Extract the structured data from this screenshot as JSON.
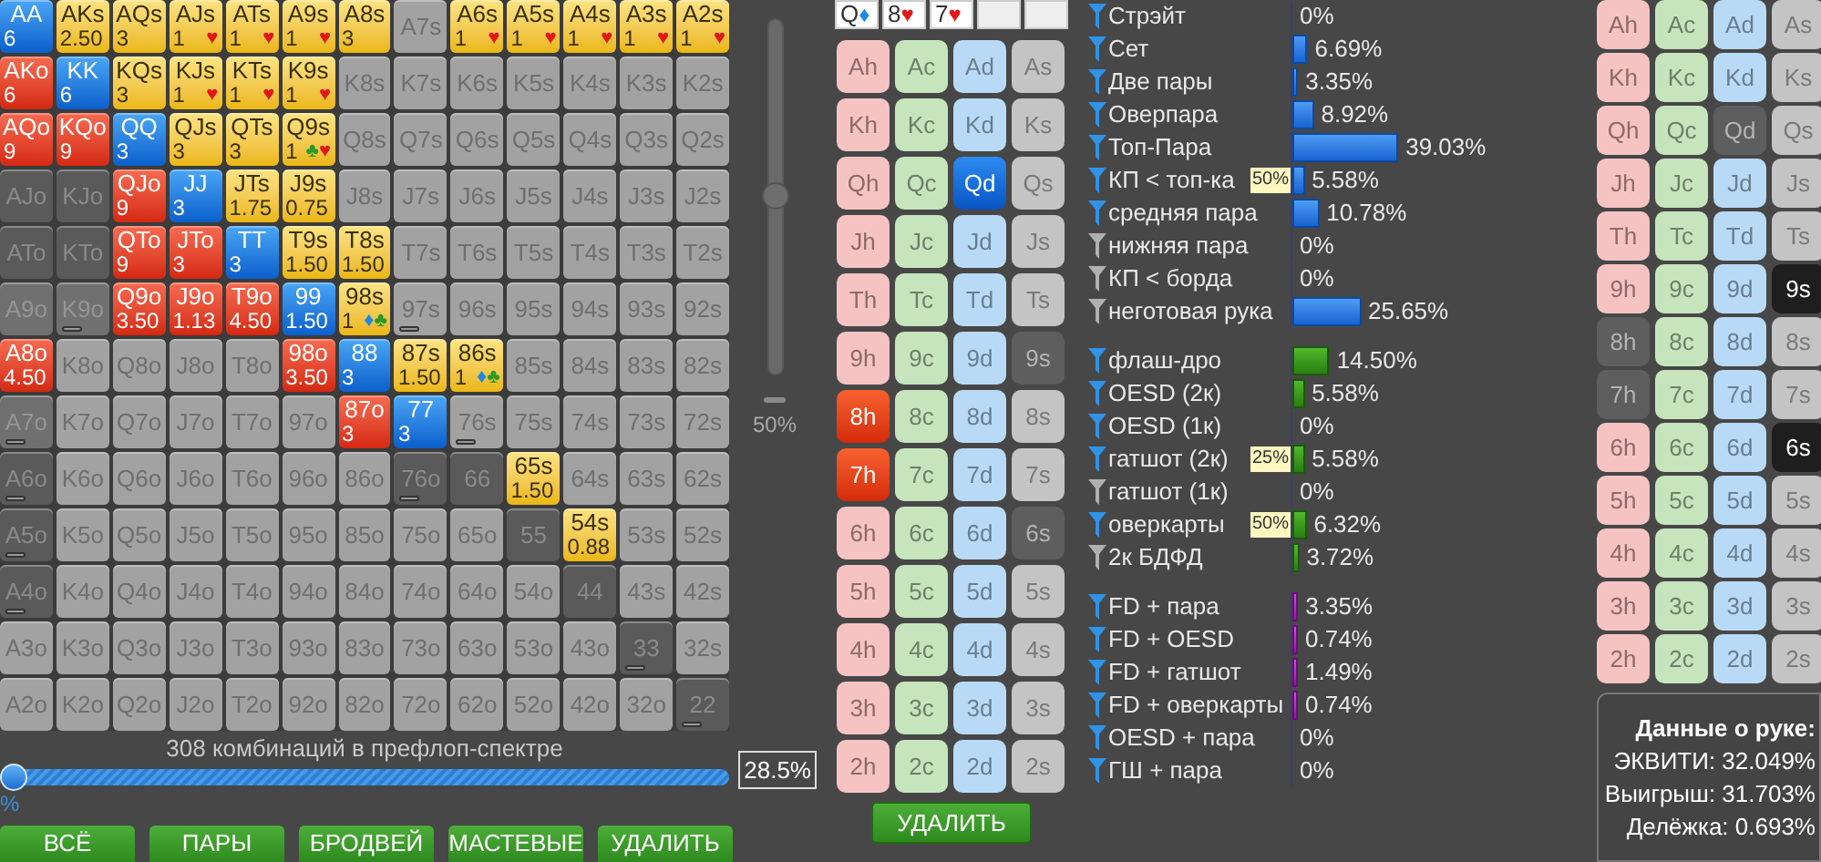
{
  "matrix": {
    "rows": [
      [
        {
          "label": "AA",
          "kind": "pair",
          "marked": false,
          "weight": "6"
        },
        {
          "label": "AKs",
          "kind": "suited",
          "marked": false,
          "weight": "2.50"
        },
        {
          "label": "AQs",
          "kind": "suited",
          "marked": false,
          "weight": "3"
        },
        {
          "label": "AJs",
          "kind": "suited",
          "marked": false,
          "weight": "1",
          "suits": [
            {
              "symbol": "♥",
              "color": "#e01818"
            }
          ]
        },
        {
          "label": "ATs",
          "kind": "suited",
          "marked": false,
          "weight": "1",
          "suits": [
            {
              "symbol": "♥",
              "color": "#e01818"
            }
          ]
        },
        {
          "label": "A9s",
          "kind": "suited",
          "marked": false,
          "weight": "1",
          "suits": [
            {
              "symbol": "♥",
              "color": "#e01818"
            }
          ]
        },
        {
          "label": "A8s",
          "kind": "suited",
          "marked": false,
          "weight": "3"
        },
        {
          "label": "A7s",
          "kind": "empty",
          "marked": false
        },
        {
          "label": "A6s",
          "kind": "suited",
          "marked": false,
          "weight": "1",
          "suits": [
            {
              "symbol": "♥",
              "color": "#e01818"
            }
          ]
        },
        {
          "label": "A5s",
          "kind": "suited",
          "marked": false,
          "weight": "1",
          "suits": [
            {
              "symbol": "♥",
              "color": "#e01818"
            }
          ]
        },
        {
          "label": "A4s",
          "kind": "suited",
          "marked": false,
          "weight": "1",
          "suits": [
            {
              "symbol": "♥",
              "color": "#e01818"
            }
          ]
        },
        {
          "label": "A3s",
          "kind": "suited",
          "marked": false,
          "weight": "1",
          "suits": [
            {
              "symbol": "♥",
              "color": "#e01818"
            }
          ]
        },
        {
          "label": "A2s",
          "kind": "suited",
          "marked": false,
          "weight": "1",
          "suits": [
            {
              "symbol": "♥",
              "color": "#e01818"
            }
          ]
        }
      ],
      [
        {
          "label": "AKo",
          "kind": "offsuit",
          "marked": false,
          "weight": "6"
        },
        {
          "label": "KK",
          "kind": "pair",
          "marked": false,
          "weight": "6"
        },
        {
          "label": "KQs",
          "kind": "suited",
          "marked": false,
          "weight": "3"
        },
        {
          "label": "KJs",
          "kind": "suited",
          "marked": false,
          "weight": "1",
          "suits": [
            {
              "symbol": "♥",
              "color": "#e01818"
            }
          ]
        },
        {
          "label": "KTs",
          "kind": "suited",
          "marked": false,
          "weight": "1",
          "suits": [
            {
              "symbol": "♥",
              "color": "#e01818"
            }
          ]
        },
        {
          "label": "K9s",
          "kind": "suited",
          "marked": false,
          "weight": "1",
          "suits": [
            {
              "symbol": "♥",
              "color": "#e01818"
            }
          ]
        },
        {
          "label": "K8s",
          "kind": "empty",
          "marked": false
        },
        {
          "label": "K7s",
          "kind": "empty",
          "marked": false
        },
        {
          "label": "K6s",
          "kind": "empty",
          "marked": false
        },
        {
          "label": "K5s",
          "kind": "empty",
          "marked": false
        },
        {
          "label": "K4s",
          "kind": "empty",
          "marked": false
        },
        {
          "label": "K3s",
          "kind": "empty",
          "marked": false
        },
        {
          "label": "K2s",
          "kind": "empty",
          "marked": false
        }
      ],
      [
        {
          "label": "AQo",
          "kind": "offsuit",
          "marked": false,
          "weight": "9"
        },
        {
          "label": "KQo",
          "kind": "offsuit",
          "marked": false,
          "weight": "9"
        },
        {
          "label": "QQ",
          "kind": "pair",
          "marked": false,
          "weight": "3"
        },
        {
          "label": "QJs",
          "kind": "suited",
          "marked": false,
          "weight": "3"
        },
        {
          "label": "QTs",
          "kind": "suited",
          "marked": false,
          "weight": "3"
        },
        {
          "label": "Q9s",
          "kind": "suited",
          "marked": false,
          "weight": "1",
          "suits": [
            {
              "symbol": "♣",
              "color": "#2a9a2a"
            },
            {
              "symbol": "♥",
              "color": "#e01818"
            }
          ]
        },
        {
          "label": "Q8s",
          "kind": "empty",
          "marked": false
        },
        {
          "label": "Q7s",
          "kind": "empty",
          "marked": false
        },
        {
          "label": "Q6s",
          "kind": "empty",
          "marked": false
        },
        {
          "label": "Q5s",
          "kind": "empty",
          "marked": false
        },
        {
          "label": "Q4s",
          "kind": "empty",
          "marked": false
        },
        {
          "label": "Q3s",
          "kind": "empty",
          "marked": false
        },
        {
          "label": "Q2s",
          "kind": "empty",
          "marked": false
        }
      ],
      [
        {
          "label": "AJo",
          "kind": "dead",
          "marked": false
        },
        {
          "label": "KJo",
          "kind": "dead",
          "marked": false
        },
        {
          "label": "QJo",
          "kind": "offsuit",
          "marked": false,
          "weight": "9"
        },
        {
          "label": "JJ",
          "kind": "pair",
          "marked": false,
          "weight": "3"
        },
        {
          "label": "JTs",
          "kind": "suited",
          "marked": false,
          "weight": "1.75"
        },
        {
          "label": "J9s",
          "kind": "suited",
          "marked": false,
          "weight": "0.75"
        },
        {
          "label": "J8s",
          "kind": "empty",
          "marked": false
        },
        {
          "label": "J7s",
          "kind": "empty",
          "marked": false
        },
        {
          "label": "J6s",
          "kind": "empty",
          "marked": false
        },
        {
          "label": "J5s",
          "kind": "empty",
          "marked": false
        },
        {
          "label": "J4s",
          "kind": "empty",
          "marked": false
        },
        {
          "label": "J3s",
          "kind": "empty",
          "marked": false
        },
        {
          "label": "J2s",
          "kind": "empty",
          "marked": false
        }
      ],
      [
        {
          "label": "ATo",
          "kind": "dead",
          "marked": false
        },
        {
          "label": "KTo",
          "kind": "dead",
          "marked": false
        },
        {
          "label": "QTo",
          "kind": "offsuit",
          "marked": false,
          "weight": "9"
        },
        {
          "label": "JTo",
          "kind": "offsuit",
          "marked": false,
          "weight": "3"
        },
        {
          "label": "TT",
          "kind": "pair",
          "marked": false,
          "weight": "3"
        },
        {
          "label": "T9s",
          "kind": "suited",
          "marked": false,
          "weight": "1.50"
        },
        {
          "label": "T8s",
          "kind": "suited",
          "marked": false,
          "weight": "1.50"
        },
        {
          "label": "T7s",
          "kind": "empty",
          "marked": false
        },
        {
          "label": "T6s",
          "kind": "empty",
          "marked": false
        },
        {
          "label": "T5s",
          "kind": "empty",
          "marked": false
        },
        {
          "label": "T4s",
          "kind": "empty",
          "marked": false
        },
        {
          "label": "T3s",
          "kind": "empty",
          "marked": false
        },
        {
          "label": "T2s",
          "kind": "empty",
          "marked": false
        }
      ],
      [
        {
          "label": "A9o",
          "kind": "dim",
          "marked": false
        },
        {
          "label": "K9o",
          "kind": "dim",
          "marked": true
        },
        {
          "label": "Q9o",
          "kind": "offsuit",
          "marked": false,
          "weight": "3.50"
        },
        {
          "label": "J9o",
          "kind": "offsuit",
          "marked": false,
          "weight": "1.13"
        },
        {
          "label": "T9o",
          "kind": "offsuit",
          "marked": false,
          "weight": "4.50"
        },
        {
          "label": "99",
          "kind": "pair",
          "marked": false,
          "weight": "1.50"
        },
        {
          "label": "98s",
          "kind": "suited",
          "marked": false,
          "weight": "1",
          "suits": [
            {
              "symbol": "♦",
              "color": "#1e88e5"
            },
            {
              "symbol": "♣",
              "color": "#2a9a2a"
            }
          ]
        },
        {
          "label": "97s",
          "kind": "empty",
          "marked": true
        },
        {
          "label": "96s",
          "kind": "empty",
          "marked": false
        },
        {
          "label": "95s",
          "kind": "empty",
          "marked": false
        },
        {
          "label": "94s",
          "kind": "empty",
          "marked": false
        },
        {
          "label": "93s",
          "kind": "empty",
          "marked": false
        },
        {
          "label": "92s",
          "kind": "empty",
          "marked": false
        }
      ],
      [
        {
          "label": "A8o",
          "kind": "offsuit",
          "marked": false,
          "weight": "4.50"
        },
        {
          "label": "K8o",
          "kind": "empty",
          "marked": false
        },
        {
          "label": "Q8o",
          "kind": "empty",
          "marked": false
        },
        {
          "label": "J8o",
          "kind": "empty",
          "marked": false
        },
        {
          "label": "T8o",
          "kind": "empty",
          "marked": false
        },
        {
          "label": "98o",
          "kind": "offsuit",
          "marked": false,
          "weight": "3.50"
        },
        {
          "label": "88",
          "kind": "pair",
          "marked": false,
          "weight": "3"
        },
        {
          "label": "87s",
          "kind": "suited",
          "marked": false,
          "weight": "1.50"
        },
        {
          "label": "86s",
          "kind": "suited",
          "marked": false,
          "weight": "1",
          "suits": [
            {
              "symbol": "♦",
              "color": "#1e88e5"
            },
            {
              "symbol": "♣",
              "color": "#2a9a2a"
            }
          ]
        },
        {
          "label": "85s",
          "kind": "empty",
          "marked": false
        },
        {
          "label": "84s",
          "kind": "empty",
          "marked": false
        },
        {
          "label": "83s",
          "kind": "empty",
          "marked": false
        },
        {
          "label": "82s",
          "kind": "empty",
          "marked": false
        }
      ],
      [
        {
          "label": "A7o",
          "kind": "dim",
          "marked": true
        },
        {
          "label": "K7o",
          "kind": "empty",
          "marked": false
        },
        {
          "label": "Q7o",
          "kind": "empty",
          "marked": false
        },
        {
          "label": "J7o",
          "kind": "empty",
          "marked": false
        },
        {
          "label": "T7o",
          "kind": "empty",
          "marked": false
        },
        {
          "label": "97o",
          "kind": "empty",
          "marked": false
        },
        {
          "label": "87o",
          "kind": "offsuit",
          "marked": false,
          "weight": "3"
        },
        {
          "label": "77",
          "kind": "pair",
          "marked": false,
          "weight": "3"
        },
        {
          "label": "76s",
          "kind": "empty",
          "marked": true
        },
        {
          "label": "75s",
          "kind": "empty",
          "marked": false
        },
        {
          "label": "74s",
          "kind": "empty",
          "marked": false
        },
        {
          "label": "73s",
          "kind": "empty",
          "marked": false
        },
        {
          "label": "72s",
          "kind": "empty",
          "marked": false
        }
      ],
      [
        {
          "label": "A6o",
          "kind": "dead",
          "marked": true
        },
        {
          "label": "K6o",
          "kind": "empty",
          "marked": false
        },
        {
          "label": "Q6o",
          "kind": "empty",
          "marked": false
        },
        {
          "label": "J6o",
          "kind": "empty",
          "marked": false
        },
        {
          "label": "T6o",
          "kind": "empty",
          "marked": false
        },
        {
          "label": "96o",
          "kind": "empty",
          "marked": false
        },
        {
          "label": "86o",
          "kind": "empty",
          "marked": false
        },
        {
          "label": "76o",
          "kind": "dead",
          "marked": true
        },
        {
          "label": "66",
          "kind": "dead",
          "marked": false
        },
        {
          "label": "65s",
          "kind": "suited",
          "marked": false,
          "weight": "1.50"
        },
        {
          "label": "64s",
          "kind": "empty",
          "marked": false
        },
        {
          "label": "63s",
          "kind": "empty",
          "marked": false
        },
        {
          "label": "62s",
          "kind": "empty",
          "marked": false
        }
      ],
      [
        {
          "label": "A5o",
          "kind": "dead",
          "marked": true
        },
        {
          "label": "K5o",
          "kind": "empty",
          "marked": false
        },
        {
          "label": "Q5o",
          "kind": "empty",
          "marked": false
        },
        {
          "label": "J5o",
          "kind": "empty",
          "marked": false
        },
        {
          "label": "T5o",
          "kind": "empty",
          "marked": false
        },
        {
          "label": "95o",
          "kind": "empty",
          "marked": false
        },
        {
          "label": "85o",
          "kind": "empty",
          "marked": false
        },
        {
          "label": "75o",
          "kind": "empty",
          "marked": false
        },
        {
          "label": "65o",
          "kind": "empty",
          "marked": false
        },
        {
          "label": "55",
          "kind": "dead",
          "marked": false
        },
        {
          "label": "54s",
          "kind": "suited",
          "marked": false,
          "weight": "0.88"
        },
        {
          "label": "53s",
          "kind": "empty",
          "marked": false
        },
        {
          "label": "52s",
          "kind": "empty",
          "marked": false
        }
      ],
      [
        {
          "label": "A4o",
          "kind": "dead",
          "marked": true
        },
        {
          "label": "K4o",
          "kind": "empty",
          "marked": false
        },
        {
          "label": "Q4o",
          "kind": "empty",
          "marked": false
        },
        {
          "label": "J4o",
          "kind": "empty",
          "marked": false
        },
        {
          "label": "T4o",
          "kind": "empty",
          "marked": false
        },
        {
          "label": "94o",
          "kind": "empty",
          "marked": false
        },
        {
          "label": "84o",
          "kind": "empty",
          "marked": false
        },
        {
          "label": "74o",
          "kind": "empty",
          "marked": false
        },
        {
          "label": "64o",
          "kind": "empty",
          "marked": false
        },
        {
          "label": "54o",
          "kind": "empty",
          "marked": false
        },
        {
          "label": "44",
          "kind": "dead",
          "marked": false
        },
        {
          "label": "43s",
          "kind": "empty",
          "marked": false
        },
        {
          "label": "42s",
          "kind": "empty",
          "marked": false
        }
      ],
      [
        {
          "label": "A3o",
          "kind": "empty",
          "marked": false
        },
        {
          "label": "K3o",
          "kind": "empty",
          "marked": false
        },
        {
          "label": "Q3o",
          "kind": "empty",
          "marked": false
        },
        {
          "label": "J3o",
          "kind": "empty",
          "marked": false
        },
        {
          "label": "T3o",
          "kind": "empty",
          "marked": false
        },
        {
          "label": "93o",
          "kind": "empty",
          "marked": false
        },
        {
          "label": "83o",
          "kind": "empty",
          "marked": false
        },
        {
          "label": "73o",
          "kind": "empty",
          "marked": false
        },
        {
          "label": "63o",
          "kind": "empty",
          "marked": false
        },
        {
          "label": "53o",
          "kind": "empty",
          "marked": false
        },
        {
          "label": "43o",
          "kind": "empty",
          "marked": false
        },
        {
          "label": "33",
          "kind": "dead",
          "marked": true
        },
        {
          "label": "32s",
          "kind": "empty",
          "marked": false
        }
      ],
      [
        {
          "label": "A2o",
          "kind": "empty",
          "marked": false
        },
        {
          "label": "K2o",
          "kind": "empty",
          "marked": false
        },
        {
          "label": "Q2o",
          "kind": "empty",
          "marked": false
        },
        {
          "label": "J2o",
          "kind": "empty",
          "marked": false
        },
        {
          "label": "T2o",
          "kind": "empty",
          "marked": false
        },
        {
          "label": "92o",
          "kind": "empty",
          "marked": false
        },
        {
          "label": "82o",
          "kind": "empty",
          "marked": false
        },
        {
          "label": "72o",
          "kind": "empty",
          "marked": false
        },
        {
          "label": "62o",
          "kind": "empty",
          "marked": false
        },
        {
          "label": "52o",
          "kind": "empty",
          "marked": false
        },
        {
          "label": "42o",
          "kind": "empty",
          "marked": false
        },
        {
          "label": "32o",
          "kind": "empty",
          "marked": false
        },
        {
          "label": "22",
          "kind": "dead",
          "marked": true
        }
      ]
    ]
  },
  "vertical_slider": {
    "level": 0.5,
    "label": "50%"
  },
  "combo_caption": "308 комбинаций в префлоп-спектре",
  "range_slider": {
    "level": 0,
    "min_label": "%",
    "value": "28.5%"
  },
  "range_buttons": [
    "ВСЁ",
    "ПАРЫ",
    "БРОДВЕЙ",
    "МАСТЕВЫЕ",
    "УДАЛИТЬ"
  ],
  "board": [
    {
      "filled": true,
      "rank": "Q",
      "suit": {
        "symbol": "♦",
        "color": "#1e88e5"
      }
    },
    {
      "filled": true,
      "rank": "8",
      "suit": {
        "symbol": "♥",
        "color": "#e01818"
      }
    },
    {
      "filled": true,
      "rank": "7",
      "suit": {
        "symbol": "♥",
        "color": "#e01818"
      }
    },
    {
      "filled": false
    },
    {
      "filled": false
    }
  ],
  "board_cards": {
    "kind": "board",
    "columns": [
      {
        "kind": "hearts",
        "cards": [
          {
            "label": "Ah",
            "selected": false,
            "disabled": false
          },
          {
            "label": "Kh",
            "selected": false,
            "disabled": false
          },
          {
            "label": "Qh",
            "selected": false,
            "disabled": false
          },
          {
            "label": "Jh",
            "selected": false,
            "disabled": false
          },
          {
            "label": "Th",
            "selected": false,
            "disabled": false
          },
          {
            "label": "9h",
            "selected": false,
            "disabled": false
          },
          {
            "label": "8h",
            "selected": true,
            "disabled": false
          },
          {
            "label": "7h",
            "selected": true,
            "disabled": false
          },
          {
            "label": "6h",
            "selected": false,
            "disabled": false
          },
          {
            "label": "5h",
            "selected": false,
            "disabled": false
          },
          {
            "label": "4h",
            "selected": false,
            "disabled": false
          },
          {
            "label": "3h",
            "selected": false,
            "disabled": false
          },
          {
            "label": "2h",
            "selected": false,
            "disabled": false
          }
        ]
      },
      {
        "kind": "clubs",
        "cards": [
          {
            "label": "Ac",
            "selected": false,
            "disabled": false
          },
          {
            "label": "Kc",
            "selected": false,
            "disabled": false
          },
          {
            "label": "Qc",
            "selected": false,
            "disabled": false
          },
          {
            "label": "Jc",
            "selected": false,
            "disabled": false
          },
          {
            "label": "Tc",
            "selected": false,
            "disabled": false
          },
          {
            "label": "9c",
            "selected": false,
            "disabled": false
          },
          {
            "label": "8c",
            "selected": false,
            "disabled": false
          },
          {
            "label": "7c",
            "selected": false,
            "disabled": false
          },
          {
            "label": "6c",
            "selected": false,
            "disabled": false
          },
          {
            "label": "5c",
            "selected": false,
            "disabled": false
          },
          {
            "label": "4c",
            "selected": false,
            "disabled": false
          },
          {
            "label": "3c",
            "selected": false,
            "disabled": false
          },
          {
            "label": "2c",
            "selected": false,
            "disabled": false
          }
        ]
      },
      {
        "kind": "diamonds",
        "cards": [
          {
            "label": "Ad",
            "selected": false,
            "disabled": false
          },
          {
            "label": "Kd",
            "selected": false,
            "disabled": false
          },
          {
            "label": "Qd",
            "selected": true,
            "disabled": false
          },
          {
            "label": "Jd",
            "selected": false,
            "disabled": false
          },
          {
            "label": "Td",
            "selected": false,
            "disabled": false
          },
          {
            "label": "9d",
            "selected": false,
            "disabled": false
          },
          {
            "label": "8d",
            "selected": false,
            "disabled": false
          },
          {
            "label": "7d",
            "selected": false,
            "disabled": false
          },
          {
            "label": "6d",
            "selected": false,
            "disabled": false
          },
          {
            "label": "5d",
            "selected": false,
            "disabled": false
          },
          {
            "label": "4d",
            "selected": false,
            "disabled": false
          },
          {
            "label": "3d",
            "selected": false,
            "disabled": false
          },
          {
            "label": "2d",
            "selected": false,
            "disabled": false
          }
        ]
      },
      {
        "kind": "spades",
        "cards": [
          {
            "label": "As",
            "selected": false,
            "disabled": false
          },
          {
            "label": "Ks",
            "selected": false,
            "disabled": false
          },
          {
            "label": "Qs",
            "selected": false,
            "disabled": false
          },
          {
            "label": "Js",
            "selected": false,
            "disabled": false
          },
          {
            "label": "Ts",
            "selected": false,
            "disabled": false
          },
          {
            "label": "9s",
            "selected": false,
            "disabled": true
          },
          {
            "label": "8s",
            "selected": false,
            "disabled": false
          },
          {
            "label": "7s",
            "selected": false,
            "disabled": false
          },
          {
            "label": "6s",
            "selected": false,
            "disabled": true
          },
          {
            "label": "5s",
            "selected": false,
            "disabled": false
          },
          {
            "label": "4s",
            "selected": false,
            "disabled": false
          },
          {
            "label": "3s",
            "selected": false,
            "disabled": false
          },
          {
            "label": "2s",
            "selected": false,
            "disabled": false
          }
        ]
      }
    ]
  },
  "board_delete_button": "УДАЛИТЬ",
  "stats": [
    {
      "kind": "made",
      "rows": [
        {
          "label": "Стрэйт",
          "active": true,
          "value": "0%"
        },
        {
          "label": "Сет",
          "active": true,
          "value": "6.69%"
        },
        {
          "label": "Две пары",
          "active": true,
          "value": "3.35%"
        },
        {
          "label": "Оверпара",
          "active": true,
          "value": "8.92%"
        },
        {
          "label": "Топ-Пара",
          "active": true,
          "value": "39.03%"
        },
        {
          "label": "КП < топ-ка",
          "badge": "50%",
          "active": true,
          "value": "5.58%"
        },
        {
          "label": "средняя пара",
          "active": true,
          "value": "10.78%"
        },
        {
          "label": "нижняя пара",
          "active": false,
          "value": "0%"
        },
        {
          "label": "КП < борда",
          "active": false,
          "value": "0%"
        },
        {
          "label": "неготовая рука",
          "active": false,
          "value": "25.65%"
        }
      ]
    },
    {
      "kind": "draw",
      "rows": [
        {
          "label": "флаш-дро",
          "active": true,
          "value": "14.50%"
        },
        {
          "label": "OESD (2к)",
          "active": true,
          "value": "5.58%"
        },
        {
          "label": "OESD (1к)",
          "active": true,
          "value": "0%"
        },
        {
          "label": "гатшот (2к)",
          "badge": "25%",
          "active": true,
          "value": "5.58%"
        },
        {
          "label": "гатшот (1к)",
          "active": false,
          "value": "0%"
        },
        {
          "label": "оверкарты",
          "badge": "50%",
          "active": true,
          "value": "6.32%"
        },
        {
          "label": "2к БДФД",
          "active": false,
          "value": "3.72%"
        }
      ]
    },
    {
      "kind": "combo",
      "rows": [
        {
          "label": "FD + пара",
          "active": true,
          "value": "3.35%"
        },
        {
          "label": "FD + OESD",
          "active": true,
          "value": "0.74%"
        },
        {
          "label": "FD + гатшот",
          "active": true,
          "value": "1.49%"
        },
        {
          "label": "FD + оверкарты",
          "active": true,
          "value": "0.74%"
        },
        {
          "label": "OESD + пара",
          "active": true,
          "value": "0%"
        },
        {
          "label": "ГШ + пара",
          "active": true,
          "value": "0%"
        }
      ]
    }
  ],
  "hand_cards": {
    "kind": "hand",
    "columns": [
      {
        "kind": "hearts",
        "cards": [
          {
            "label": "Ah",
            "selected": false,
            "disabled": false
          },
          {
            "label": "Kh",
            "selected": false,
            "disabled": false
          },
          {
            "label": "Qh",
            "selected": false,
            "disabled": false
          },
          {
            "label": "Jh",
            "selected": false,
            "disabled": false
          },
          {
            "label": "Th",
            "selected": false,
            "disabled": false
          },
          {
            "label": "9h",
            "selected": false,
            "disabled": false
          },
          {
            "label": "8h",
            "selected": false,
            "disabled": true
          },
          {
            "label": "7h",
            "selected": false,
            "disabled": true
          },
          {
            "label": "6h",
            "selected": false,
            "disabled": false
          },
          {
            "label": "5h",
            "selected": false,
            "disabled": false
          },
          {
            "label": "4h",
            "selected": false,
            "disabled": false
          },
          {
            "label": "3h",
            "selected": false,
            "disabled": false
          },
          {
            "label": "2h",
            "selected": false,
            "disabled": false
          }
        ]
      },
      {
        "kind": "clubs",
        "cards": [
          {
            "label": "Ac",
            "selected": false,
            "disabled": false
          },
          {
            "label": "Kc",
            "selected": false,
            "disabled": false
          },
          {
            "label": "Qc",
            "selected": false,
            "disabled": false
          },
          {
            "label": "Jc",
            "selected": false,
            "disabled": false
          },
          {
            "label": "Tc",
            "selected": false,
            "disabled": false
          },
          {
            "label": "9c",
            "selected": false,
            "disabled": false
          },
          {
            "label": "8c",
            "selected": false,
            "disabled": false
          },
          {
            "label": "7c",
            "selected": false,
            "disabled": false
          },
          {
            "label": "6c",
            "selected": false,
            "disabled": false
          },
          {
            "label": "5c",
            "selected": false,
            "disabled": false
          },
          {
            "label": "4c",
            "selected": false,
            "disabled": false
          },
          {
            "label": "3c",
            "selected": false,
            "disabled": false
          },
          {
            "label": "2c",
            "selected": false,
            "disabled": false
          }
        ]
      },
      {
        "kind": "diamonds",
        "cards": [
          {
            "label": "Ad",
            "selected": false,
            "disabled": false
          },
          {
            "label": "Kd",
            "selected": false,
            "disabled": false
          },
          {
            "label": "Qd",
            "selected": false,
            "disabled": true
          },
          {
            "label": "Jd",
            "selected": false,
            "disabled": false
          },
          {
            "label": "Td",
            "selected": false,
            "disabled": false
          },
          {
            "label": "9d",
            "selected": false,
            "disabled": false
          },
          {
            "label": "8d",
            "selected": false,
            "disabled": false
          },
          {
            "label": "7d",
            "selected": false,
            "disabled": false
          },
          {
            "label": "6d",
            "selected": false,
            "disabled": false
          },
          {
            "label": "5d",
            "selected": false,
            "disabled": false
          },
          {
            "label": "4d",
            "selected": false,
            "disabled": false
          },
          {
            "label": "3d",
            "selected": false,
            "disabled": false
          },
          {
            "label": "2d",
            "selected": false,
            "disabled": false
          }
        ]
      },
      {
        "kind": "spades",
        "cards": [
          {
            "label": "As",
            "selected": false,
            "disabled": false
          },
          {
            "label": "Ks",
            "selected": false,
            "disabled": false
          },
          {
            "label": "Qs",
            "selected": false,
            "disabled": false
          },
          {
            "label": "Js",
            "selected": false,
            "disabled": false
          },
          {
            "label": "Ts",
            "selected": false,
            "disabled": false
          },
          {
            "label": "9s",
            "selected": true,
            "disabled": false
          },
          {
            "label": "8s",
            "selected": false,
            "disabled": false
          },
          {
            "label": "7s",
            "selected": false,
            "disabled": false
          },
          {
            "label": "6s",
            "selected": true,
            "disabled": false
          },
          {
            "label": "5s",
            "selected": false,
            "disabled": false
          },
          {
            "label": "4s",
            "selected": false,
            "disabled": false
          },
          {
            "label": "3s",
            "selected": false,
            "disabled": false
          },
          {
            "label": "2s",
            "selected": false,
            "disabled": false
          }
        ]
      }
    ]
  },
  "hand_info": {
    "title": "Данные о руке:",
    "lines": [
      "ЭКВИТИ: 32.049%",
      "Выигрыш: 31.703%",
      "Делёжка: 0.693%"
    ]
  }
}
